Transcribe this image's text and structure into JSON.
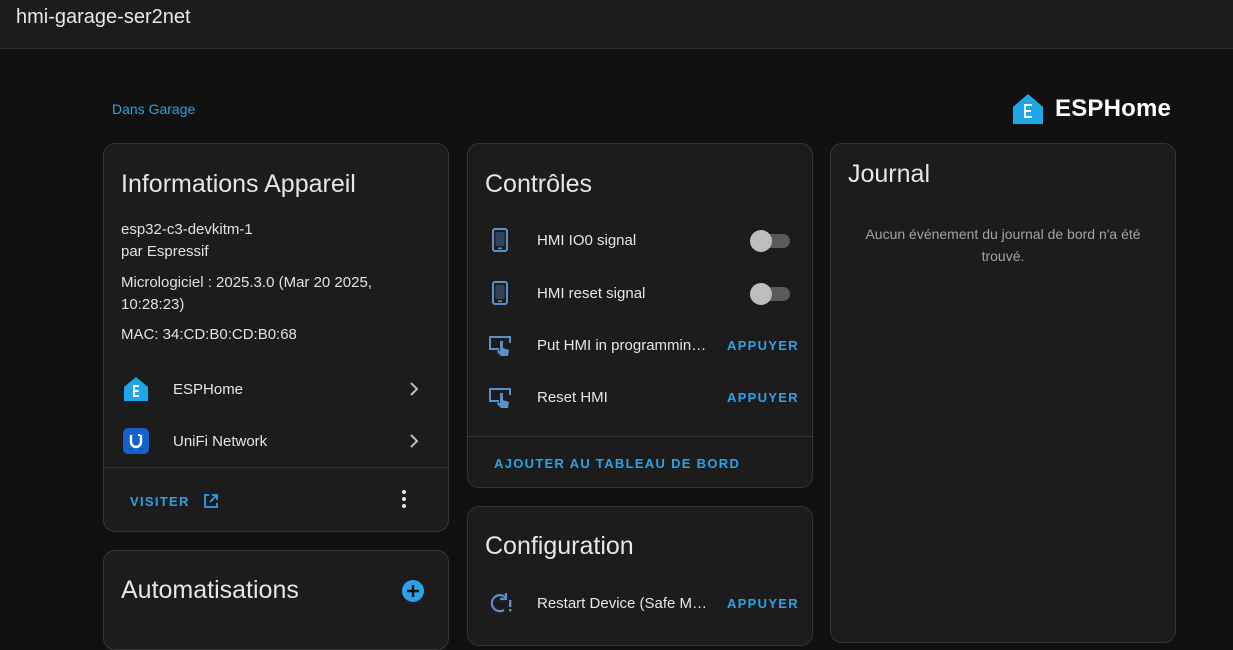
{
  "window": {
    "title": "hmi-garage-ser2net"
  },
  "breadcrumb": {
    "area": "Dans Garage"
  },
  "brand": {
    "name": "ESPHome",
    "color": "#1ea7e8"
  },
  "device_info": {
    "title": "Informations Appareil",
    "model": "esp32-c3-devkitm-1",
    "manufacturer": "par Espressif",
    "firmware_line1": "Micrologiciel : 2025.3.0 (Mar 20 2025,",
    "firmware_line2": "10:28:23)",
    "mac": "MAC: 34:CD:B0:CD:B0:68",
    "integrations": [
      {
        "label": "ESPHome",
        "icon": "esphome-icon"
      },
      {
        "label": "UniFi Network",
        "icon": "unifi-icon"
      }
    ],
    "visit_label": "VISITER"
  },
  "automations": {
    "title": "Automatisations"
  },
  "controls": {
    "title": "Contrôles",
    "items": [
      {
        "label": "HMI IO0 signal",
        "type": "switch",
        "state": "off",
        "icon": "cellphone-icon"
      },
      {
        "label": "HMI reset signal",
        "type": "switch",
        "state": "off",
        "icon": "cellphone-icon"
      },
      {
        "label": "Put HMI in programmin…",
        "type": "button",
        "action": "APPUYER",
        "icon": "gesture-tap-button-icon"
      },
      {
        "label": "Reset HMI",
        "type": "button",
        "action": "APPUYER",
        "icon": "gesture-tap-button-icon"
      }
    ],
    "add_to_dashboard": "AJOUTER AU TABLEAU DE BORD"
  },
  "configuration": {
    "title": "Configuration",
    "items": [
      {
        "label": "Restart Device (Safe M…",
        "action": "APPUYER",
        "icon": "restart-alert-icon"
      }
    ]
  },
  "journal": {
    "title": "Journal",
    "empty_line1": "Aucun événement du journal de bord n'a été",
    "empty_line2": "trouvé."
  },
  "colors": {
    "accent": "#2aa3e8",
    "background": "#111111",
    "card": "#1c1c1c"
  }
}
